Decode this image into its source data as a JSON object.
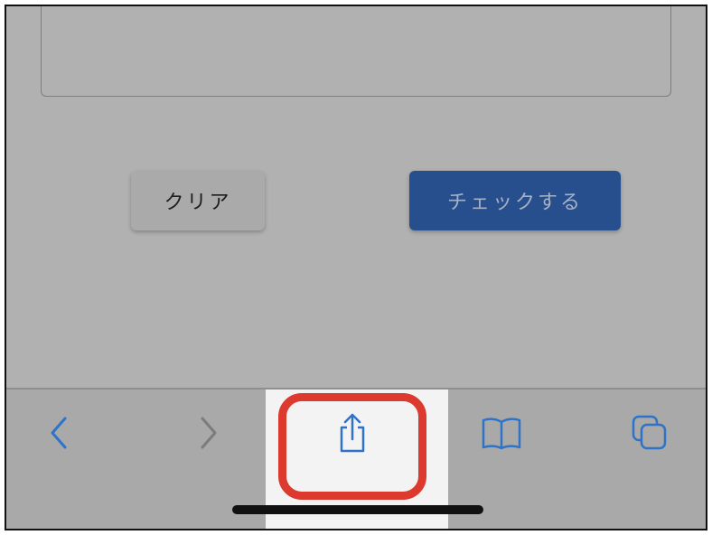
{
  "form": {
    "textarea_value": "",
    "clear_button_label": "クリア",
    "check_button_label": "チェックする"
  },
  "toolbar": {
    "icons": [
      "back-icon",
      "forward-icon",
      "share-icon",
      "bookmarks-icon",
      "tabs-icon"
    ],
    "colors": {
      "accent": "#2f73c9",
      "disabled": "#7c7c7c",
      "highlight": "#dc3a2e"
    }
  }
}
